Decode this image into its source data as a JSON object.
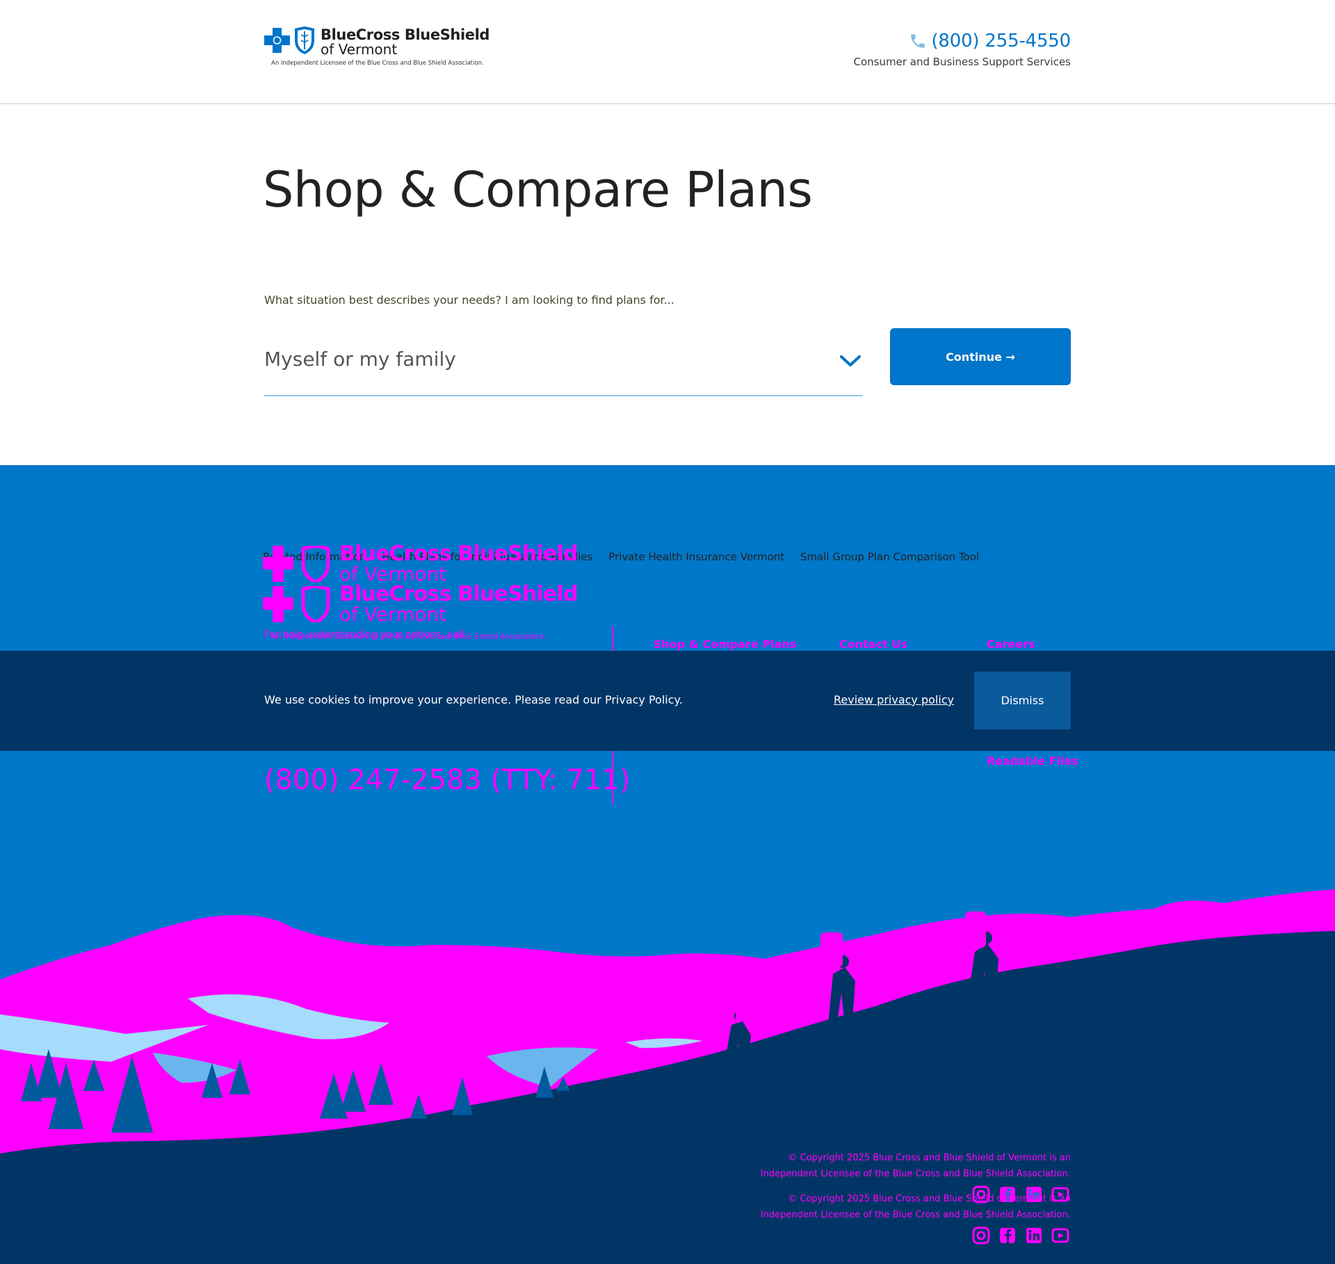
{
  "header": {
    "logo_line1": "BlueCross BlueShield",
    "logo_line2": "of Vermont",
    "logo_tagline": "An Independent Licensee of the Blue Cross and Blue Shield Association.",
    "phone": "(800) 255-4550",
    "phone_subtitle": "Consumer and Business Support Services"
  },
  "main": {
    "title": "Shop & Compare Plans",
    "question": "What situation best describes your needs? I am looking to find plans for...",
    "select_value": "Myself or my family",
    "continue_label": "Continue →"
  },
  "footer": {
    "related_links": [
      "Related Information",
      "Health Plans for Individuals and Families",
      "Private Health Insurance Vermont",
      "Small Group Plan Comparison Tool"
    ],
    "logo_line1": "BlueCross BlueShield",
    "logo_line2": "of Vermont",
    "logo_tagline": "An Independent Licensee of the Blue Cross and Blue Shield Association.",
    "lead_text": "For help understanding your options, call:",
    "nav": {
      "shop": "Shop & Compare Plans",
      "contact": "Contact Us",
      "careers": "Careers",
      "readable": "Readable Files"
    },
    "phone": "(800) 247-2583 (TTY: 711)",
    "copyright_line1": "© Copyright 2025 Blue Cross and Blue Shield of Vermont is an",
    "copyright_line2": "Independent Licensee of the Blue Cross and Blue Shield Association.",
    "social_icons": [
      "instagram-icon",
      "facebook-icon",
      "linkedin-icon",
      "youtube-icon"
    ]
  },
  "cookie": {
    "text": "We use cookies to improve your experience. Please read our Privacy Policy.",
    "link": "Review privacy policy",
    "dismiss": "Dismiss"
  },
  "colors": {
    "brand_blue": "#0075c9",
    "footer_blue": "#0077c8",
    "navy": "#003566",
    "magenta": "#ff00ff",
    "lake_blue": "#a5dbfb"
  }
}
